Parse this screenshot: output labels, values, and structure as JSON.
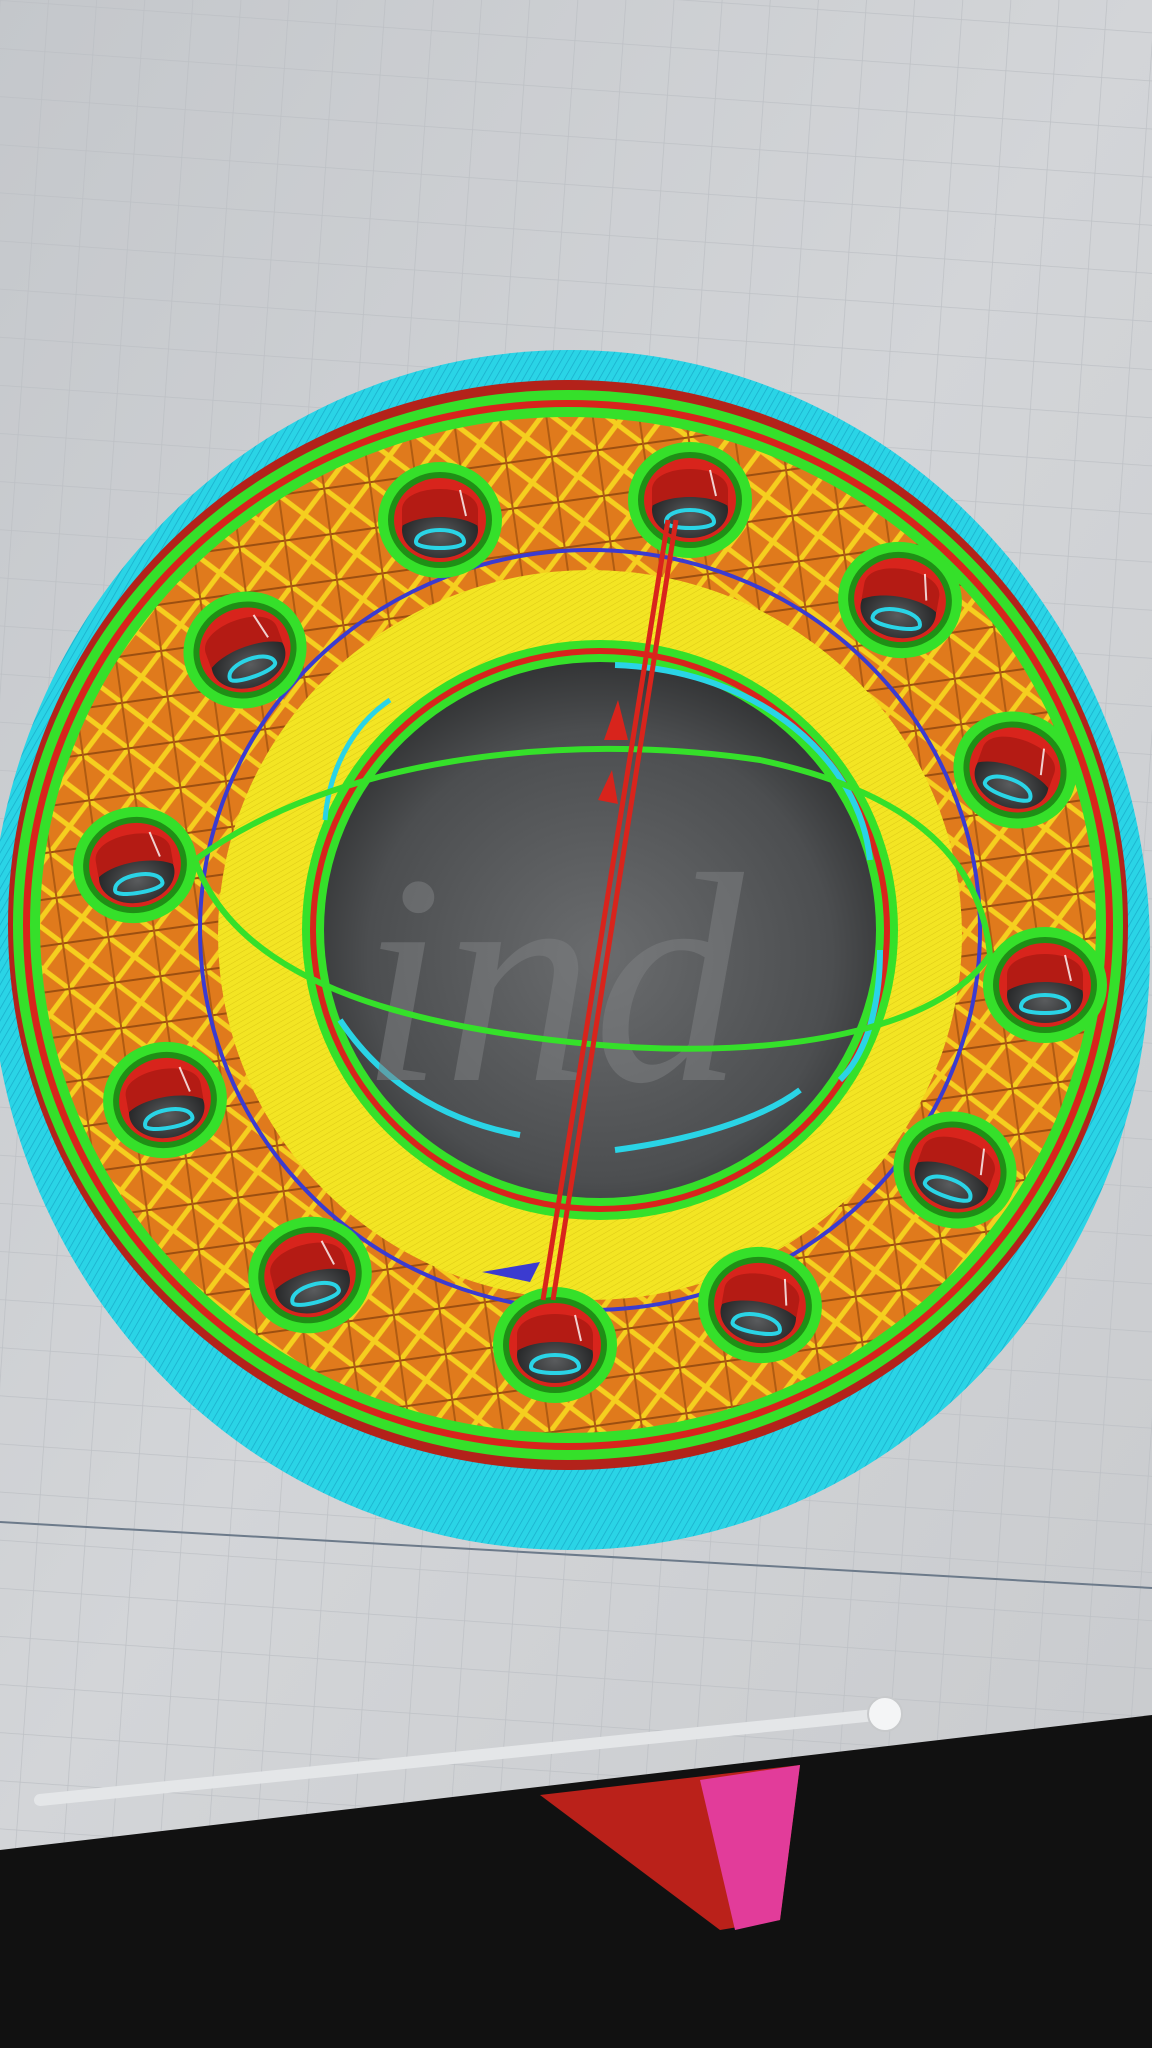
{
  "app": {
    "view": "layer-preview",
    "watermark_text": "ind"
  },
  "colors": {
    "build_plate": "#cfd1d4",
    "grid_line": "#bfc2c6",
    "skirt": "#2ad4e6",
    "outer_wall": "#d8241c",
    "inner_wall": "#35e02a",
    "infill": "#e07a1c",
    "top_bottom": "#f0e21f",
    "support": "#f2f0e0",
    "travel": "#3b3bd0",
    "shadow": "#2e2f30",
    "slider_track": "#e4e6e8",
    "bezel": "#111111",
    "object_pink": "#e23c9a"
  },
  "layer_slider": {
    "value_fraction": 1.0
  },
  "holes": [
    {
      "id": "hole-1"
    },
    {
      "id": "hole-2"
    },
    {
      "id": "hole-3"
    },
    {
      "id": "hole-4"
    },
    {
      "id": "hole-5"
    },
    {
      "id": "hole-6"
    },
    {
      "id": "hole-7"
    },
    {
      "id": "hole-8"
    },
    {
      "id": "hole-9"
    },
    {
      "id": "hole-10"
    },
    {
      "id": "hole-11"
    },
    {
      "id": "hole-12"
    }
  ]
}
